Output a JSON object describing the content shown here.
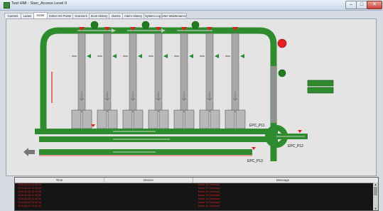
{
  "window": {
    "title": "Test HMI - Stan_Access Level 0",
    "min_label": "–",
    "max_label": "□",
    "close_label": "✕"
  },
  "tabs": [
    "Cartons",
    "Lanes",
    "Sorter",
    "Sorter HH Points",
    "Scanners",
    "Scan History",
    "Alarms",
    "Alarm History",
    "System Log",
    "User Maintenance"
  ],
  "active_tab": "Sorter",
  "diagram": {
    "conveyor_color": "#2e8b2e",
    "lane_color": "#a9a9a9",
    "alarm_color": "#e02020",
    "station_labels": [
      "EPC_P11",
      "EPC_P12",
      "EPC_P13"
    ],
    "status_buttons": [
      "",
      ""
    ]
  },
  "alarm_grid": {
    "columns": [
      "Time",
      "Device",
      "Message"
    ],
    "row_color": "#e02020",
    "rows": [
      {
        "time": "2016-06-06 11:40:46",
        "message": "Motor 18 Overload"
      },
      {
        "time": "2016-06-06 11:40:46",
        "message": "Motor 17 Overload"
      },
      {
        "time": "2016-06-06 11:40:46",
        "message": "Motor 16 Overload"
      },
      {
        "time": "2016-06-06 11:40:46",
        "message": "Motor 15 Overload"
      },
      {
        "time": "2016-06-06 11:40:46",
        "message": "Motor 14 Overload"
      },
      {
        "time": "2016-06-06 11:40:46",
        "message": "Motor 13 Overload"
      },
      {
        "time": "2016-06-06 11:40:46",
        "message": "Motor 12 Overload"
      }
    ]
  }
}
